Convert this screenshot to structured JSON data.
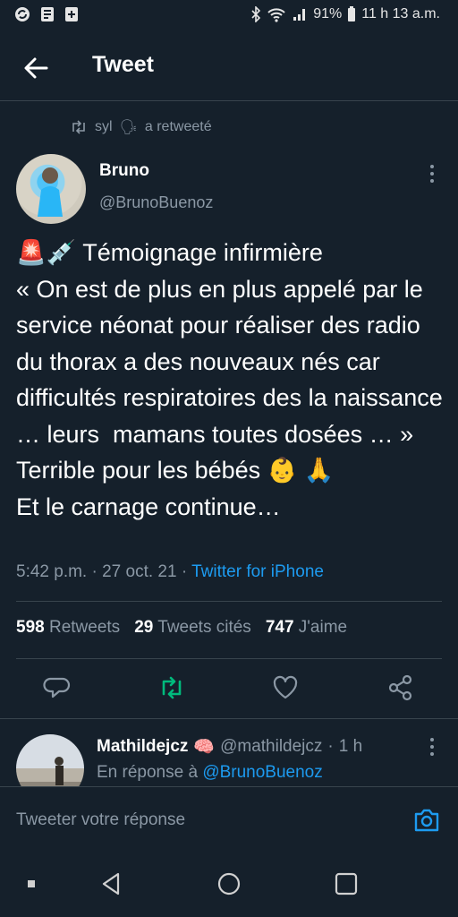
{
  "status_bar": {
    "battery": "91%",
    "time": "11 h 13 a.m."
  },
  "header": {
    "title": "Tweet"
  },
  "retweet_context": {
    "user": "syl",
    "emoji": "🗣",
    "label": "a retweeté"
  },
  "tweet": {
    "author_name": "Bruno",
    "author_handle": "@BrunoBuenoz",
    "text": "🚨💉 Témoignage infirmière\n« On est de plus en plus appelé par le service néonat pour réaliser des radio du thorax a des nouveaux nés car difficultés respiratoires des la naissance … leurs  mamans toutes dosées … »\nTerrible pour les bébés 👶 🙏\nEt le carnage continue…",
    "time": "5:42 p.m.",
    "date": "27 oct. 21",
    "source": "Twitter for iPhone",
    "retweets_count": "598",
    "retweets_label": "Retweets",
    "quotes_count": "29",
    "quotes_label": "Tweets cités",
    "likes_count": "747",
    "likes_label": "J'aime"
  },
  "reply": {
    "author_name": "Mathildejcz",
    "emoji": "🧠",
    "author_handle": "@mathildejcz",
    "time_ago": "1 h",
    "in_reply_prefix": "En réponse à",
    "in_reply_handle": "@BrunoBuenoz"
  },
  "compose": {
    "placeholder": "Tweeter votre réponse"
  },
  "colors": {
    "background": "#15202b",
    "accent": "#1d9bf0",
    "retweet_green": "#00ba7c",
    "muted": "#8b98a5"
  }
}
